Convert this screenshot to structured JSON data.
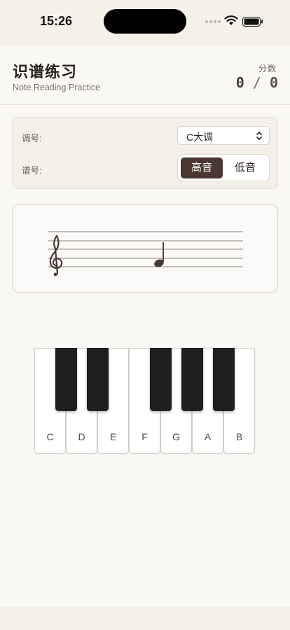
{
  "status_bar": {
    "time": "15:26",
    "icons": [
      "cellular-dots-icon",
      "wifi-icon",
      "battery-icon"
    ]
  },
  "header": {
    "title": "识谱练习",
    "subtitle": "Note Reading Practice",
    "score_label": "分数",
    "score_correct": "0",
    "score_separator": " / ",
    "score_total": "0"
  },
  "settings": {
    "key_label": "调号:",
    "key_value": "C大调",
    "clef_label": "谱号:",
    "clef_options": [
      "高音",
      "低音"
    ],
    "clef_selected": "高音"
  },
  "staff": {
    "clef_symbol": "𝄞",
    "clef_icon": "treble-clef-icon",
    "note_icon": "quarter-note-icon"
  },
  "piano": {
    "white_keys": [
      "C",
      "D",
      "E",
      "F",
      "G",
      "A",
      "B"
    ],
    "black_keys": [
      "C#",
      "D#",
      "F#",
      "G#",
      "A#"
    ]
  },
  "colors": {
    "background": "#f5f1e8",
    "card": "#faf8f5",
    "accent": "#4a3731",
    "black_key": "#1f1f1f"
  }
}
